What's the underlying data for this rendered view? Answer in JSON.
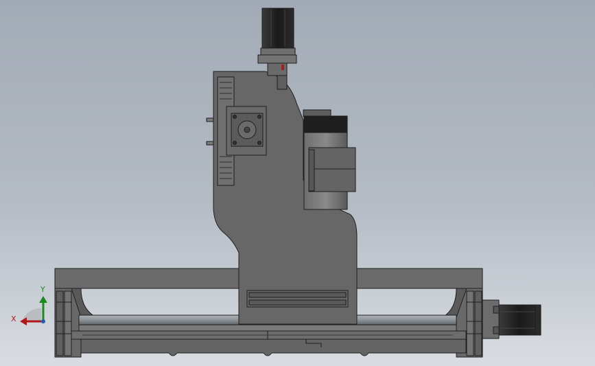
{
  "triad": {
    "x_label": "X",
    "y_label": "Y",
    "x_color": "#b01818",
    "y_color": "#1c8a1c"
  },
  "colors": {
    "body": "#676767",
    "body_light": "#7a7a7a",
    "edge": "#1e1e1e",
    "motor_black": "#202020",
    "rail": "#9aa0a4"
  }
}
